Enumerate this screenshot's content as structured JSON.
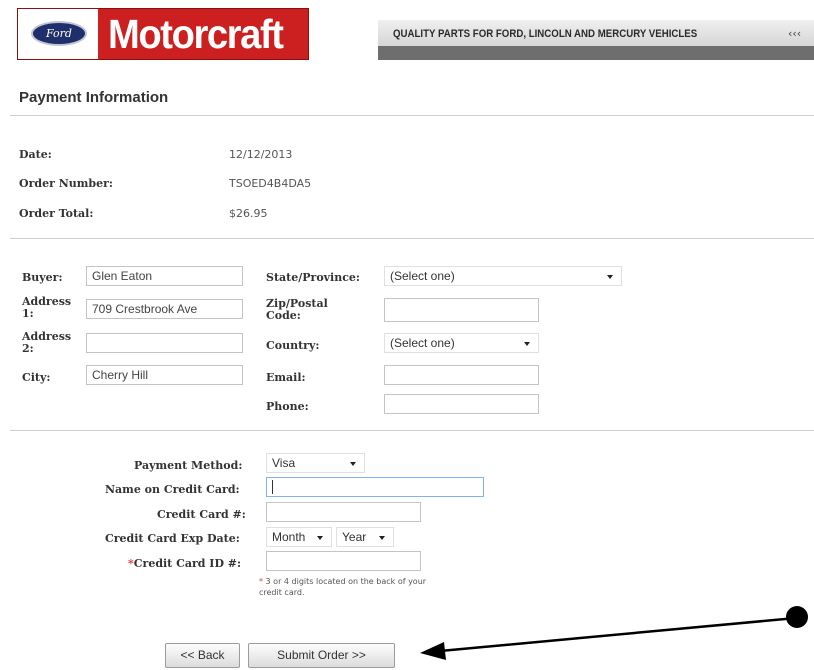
{
  "header": {
    "ford_logo_text": "Ford",
    "brand": "Motorcraft",
    "tagline": "QUALITY PARTS FOR FORD, LINCOLN AND MERCURY VEHICLES",
    "tag_chevrons": "‹‹‹",
    "brand_red": "#cc1f1f",
    "ford_blue": "#1f2f6b"
  },
  "page": {
    "title": "Payment Information"
  },
  "order": {
    "date_label": "Date:",
    "date_value": "12/12/2013",
    "number_label": "Order Number:",
    "number_value": "TSOED4B4DA5",
    "total_label": "Order Total:",
    "total_value": "$26.95"
  },
  "address": {
    "buyer_label": "Buyer:",
    "buyer_value": "Glen Eaton",
    "address1_label": "Address 1:",
    "address1_value": "709 Crestbrook Ave",
    "address2_label": "Address 2:",
    "address2_value": "",
    "city_label": "City:",
    "city_value": "Cherry Hill",
    "state_label": "State/Province:",
    "state_value": "(Select one)",
    "zip_label": "Zip/Postal Code:",
    "zip_value": "",
    "country_label": "Country:",
    "country_value": "(Select one)",
    "email_label": "Email:",
    "email_value": "",
    "phone_label": "Phone:",
    "phone_value": ""
  },
  "payment": {
    "method_label": "Payment Method:",
    "method_value": "Visa",
    "name_label": "Name on Credit Card:",
    "name_value": "",
    "card_label": "Credit Card #:",
    "card_value": "",
    "exp_label": "Credit Card Exp Date:",
    "exp_month": "Month",
    "exp_year": "Year",
    "id_required_mark": "*",
    "id_label": "Credit Card ID #:",
    "id_value": "",
    "id_note_mark": "*",
    "id_note": "3 or 4 digits located on the back of your credit card."
  },
  "actions": {
    "back_label": "<< Back",
    "submit_label": "Submit Order >>"
  }
}
